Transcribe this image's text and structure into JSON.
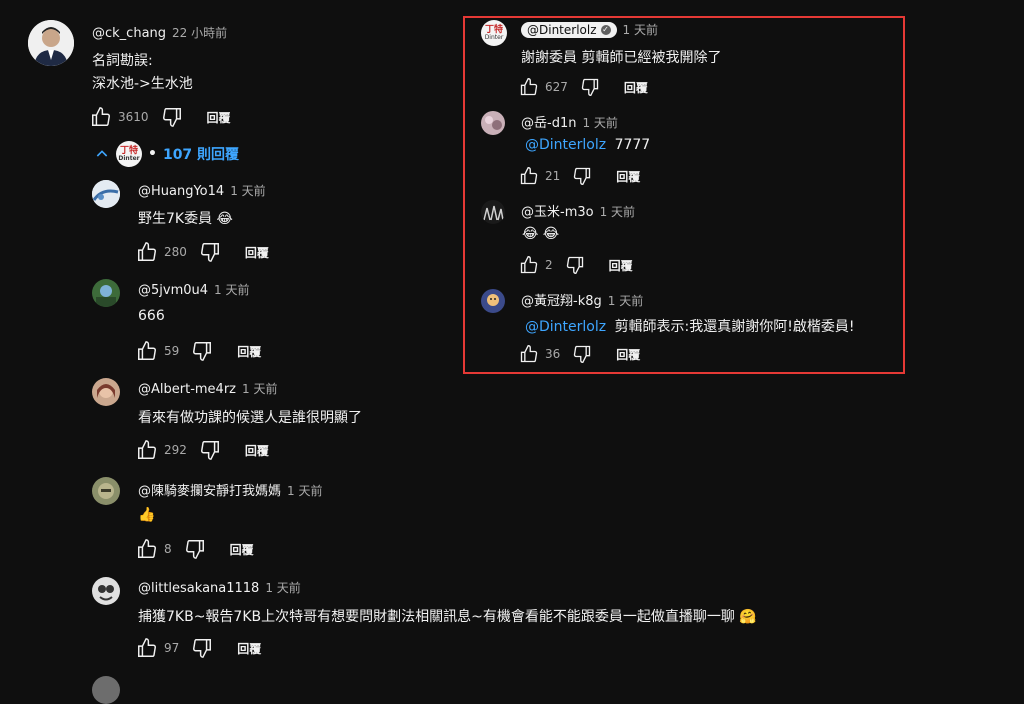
{
  "main_comment": {
    "author": "@ck_chang",
    "time": "22 小時前",
    "line1": "名詞勘誤:",
    "line2": "深水池->生水池",
    "likes": "3610",
    "reply": "回覆"
  },
  "replies_toggle": {
    "label": "107 則回覆",
    "dot": "•",
    "chip_line1": "丁特",
    "chip_line2": "Dinter"
  },
  "left_replies": [
    {
      "author": "@HuangYo14",
      "time": "1 天前",
      "text": "野生7K委員 😂",
      "likes": "280",
      "reply": "回覆"
    },
    {
      "author": "@5jvm0u4",
      "time": "1 天前",
      "text": "666",
      "likes": "59",
      "reply": "回覆"
    },
    {
      "author": "@Albert-me4rz",
      "time": "1 天前",
      "text": "看來有做功課的候選人是誰很明顯了",
      "likes": "292",
      "reply": "回覆"
    },
    {
      "author": "@陳騎麥攔安靜打我媽媽",
      "time": "1 天前",
      "text": "👍",
      "likes": "8",
      "reply": "回覆"
    },
    {
      "author": "@littlesakana1118",
      "time": "1 天前",
      "text": "捕獲7KB~報告7KB上次特哥有想要問財劃法相關訊息~有機會看能不能跟委員一起做直播聊一聊 🤗",
      "likes": "97",
      "reply": "回覆"
    }
  ],
  "right_replies": [
    {
      "author": "@Dinterlolz",
      "time": "1 天前",
      "text": "謝謝委員 剪輯師已經被我開除了",
      "likes": "627",
      "reply": "回覆"
    },
    {
      "author": "@岳-d1n",
      "time": "1 天前",
      "mention": "@Dinterlolz",
      "text": "7777",
      "likes": "21",
      "reply": "回覆"
    },
    {
      "author": "@玉米-m3o",
      "time": "1 天前",
      "text": "😂 😂",
      "likes": "2",
      "reply": "回覆"
    },
    {
      "author": "@黃冠翔-k8g",
      "time": "1 天前",
      "mention": "@Dinterlolz",
      "text": "剪輯師表示:我還真謝謝你阿!啟楷委員!",
      "likes": "36",
      "reply": "回覆"
    }
  ],
  "colors": {
    "background": "#0f0f0f",
    "text": "#f1f1f1",
    "secondary": "#aaaaaa",
    "link": "#3ea6ff",
    "highlight_box": "#e53935"
  },
  "icons": {
    "like": "thumb-up-icon",
    "dislike": "thumb-down-icon",
    "collapse": "chevron-up-icon",
    "verified": "check-icon"
  }
}
